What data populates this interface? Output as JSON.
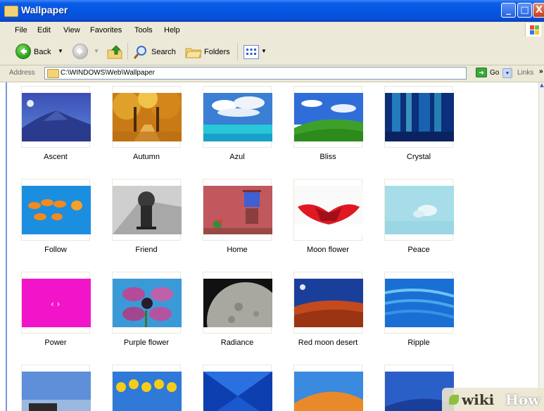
{
  "window": {
    "title": "Wallpaper",
    "icon": "folder-icon"
  },
  "menu": {
    "items": [
      "File",
      "Edit",
      "View",
      "Favorites",
      "Tools",
      "Help"
    ]
  },
  "toolbar": {
    "back": "Back",
    "search": "Search",
    "folders": "Folders"
  },
  "address": {
    "label": "Address",
    "path": "C:\\WINDOWS\\Web\\Wallpaper",
    "go": "Go",
    "links": "Links"
  },
  "files": [
    {
      "name": "Ascent"
    },
    {
      "name": "Autumn"
    },
    {
      "name": "Azul"
    },
    {
      "name": "Bliss"
    },
    {
      "name": "Crystal"
    },
    {
      "name": "Follow"
    },
    {
      "name": "Friend"
    },
    {
      "name": "Home"
    },
    {
      "name": "Moon flower"
    },
    {
      "name": "Peace"
    },
    {
      "name": "Power"
    },
    {
      "name": "Purple flower"
    },
    {
      "name": "Radiance"
    },
    {
      "name": "Red moon desert"
    },
    {
      "name": "Ripple"
    },
    {
      "name": ""
    },
    {
      "name": ""
    },
    {
      "name": ""
    },
    {
      "name": ""
    },
    {
      "name": ""
    }
  ],
  "watermark": {
    "left": "wiki",
    "right": "How"
  }
}
